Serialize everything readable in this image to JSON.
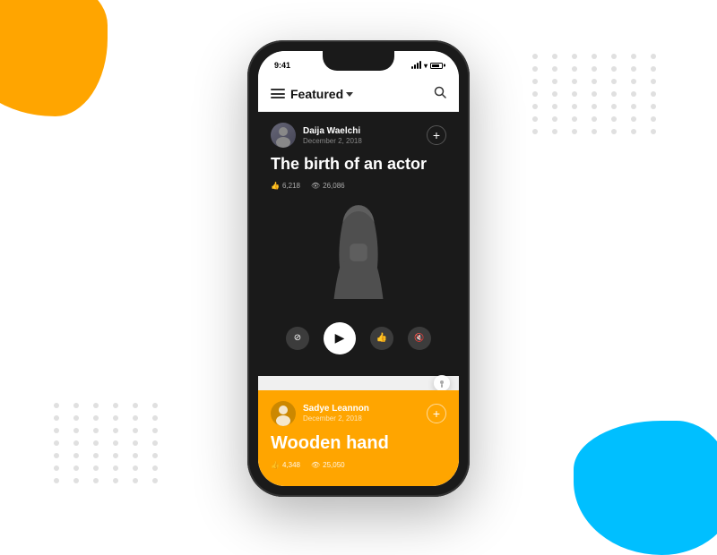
{
  "background": {
    "blob_orange_color": "#FFA500",
    "blob_cyan_color": "#00BFFF",
    "dot_color": "#e0e0e0"
  },
  "status_bar": {
    "time": "9:41",
    "battery": "100%"
  },
  "header": {
    "title": "Featured",
    "menu_icon": "hamburger-icon",
    "search_icon": "search-icon"
  },
  "cards": [
    {
      "id": "card-1",
      "theme": "dark",
      "user": {
        "name": "Daija Waelchi",
        "date": "December 2, 2018"
      },
      "title": "The birth of an actor",
      "stats": {
        "likes": "6,218",
        "views": "26,086"
      },
      "has_player": true
    },
    {
      "id": "card-2",
      "theme": "orange",
      "user": {
        "name": "Sadye Leannon",
        "date": "December 2, 2018"
      },
      "title": "Wooden hand",
      "stats": {
        "likes": "4,348",
        "views": "25,050"
      },
      "has_player": false
    }
  ],
  "controls": {
    "no_symbol": "⊘",
    "play": "▶",
    "like": "👍",
    "mute": "🔇",
    "add": "+"
  }
}
